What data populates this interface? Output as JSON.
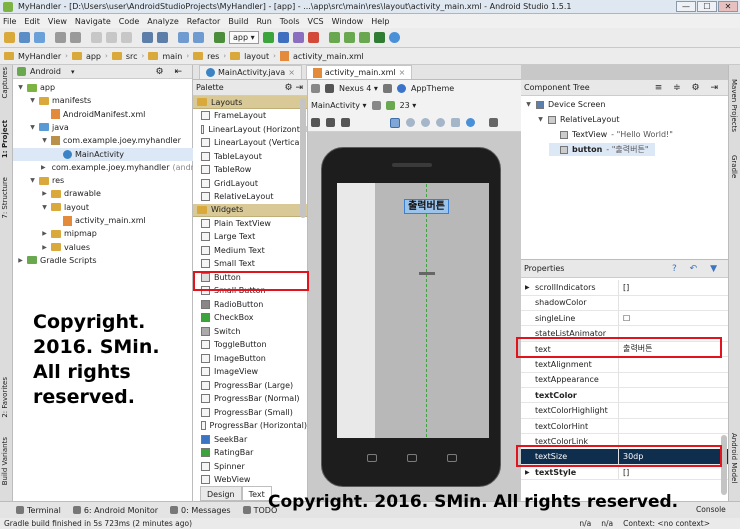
{
  "window": {
    "title": "MyHandler - [D:\\Users\\user\\AndroidStudioProjects\\MyHandler] - [app] - ...\\app\\src\\main\\res\\layout\\activity_main.xml - Android Studio 1.5.1",
    "minimize": "—",
    "maximize": "☐",
    "close": "✕"
  },
  "menu": [
    "File",
    "Edit",
    "View",
    "Navigate",
    "Code",
    "Analyze",
    "Refactor",
    "Build",
    "Run",
    "Tools",
    "VCS",
    "Window",
    "Help"
  ],
  "toolbar": {
    "run_config": "app ▾"
  },
  "breadcrumb": [
    "MyHandler",
    "app",
    "src",
    "main",
    "res",
    "layout",
    "activity_main.xml"
  ],
  "project": {
    "view_selector": "Android",
    "tree": [
      {
        "label": "app",
        "depth": 0,
        "icon": "folder",
        "color": "#7cb342"
      },
      {
        "label": "manifests",
        "depth": 1,
        "icon": "folder",
        "color": "#d9a93c"
      },
      {
        "label": "AndroidManifest.xml",
        "depth": 2,
        "icon": "xml",
        "color": "#e38b3a"
      },
      {
        "label": "java",
        "depth": 1,
        "icon": "folder",
        "color": "#5a9bd5"
      },
      {
        "label": "com.example.joey.myhandler",
        "depth": 2,
        "icon": "package",
        "color": "#b9914a"
      },
      {
        "label": "MainActivity",
        "depth": 3,
        "icon": "class",
        "color": "#3b83c4"
      },
      {
        "label": "com.example.joey.myhandler",
        "suffix": "(andro",
        "depth": 2,
        "icon": "package",
        "color": "#b9914a"
      },
      {
        "label": "res",
        "depth": 1,
        "icon": "folder",
        "color": "#d9a93c"
      },
      {
        "label": "drawable",
        "depth": 2,
        "icon": "folder",
        "color": "#d9a93c"
      },
      {
        "label": "layout",
        "depth": 2,
        "icon": "folder",
        "color": "#d9a93c"
      },
      {
        "label": "activity_main.xml",
        "depth": 3,
        "icon": "xml",
        "color": "#e38b3a"
      },
      {
        "label": "mipmap",
        "depth": 2,
        "icon": "folder",
        "color": "#d9a93c"
      },
      {
        "label": "values",
        "depth": 2,
        "icon": "folder",
        "color": "#d9a93c"
      },
      {
        "label": "Gradle Scripts",
        "depth": 0,
        "icon": "gradle",
        "color": "#6aa84f"
      }
    ]
  },
  "left_tool_tabs": [
    "Captures",
    "1: Project",
    "7: Structure",
    "2: Favorites",
    "Build Variants"
  ],
  "right_tool_tabs": [
    "Maven Projects",
    "Gradle",
    "Android Model"
  ],
  "editor_tabs": [
    {
      "label": "MainActivity.java",
      "active": false
    },
    {
      "label": "activity_main.xml",
      "active": true
    }
  ],
  "palette": {
    "title": "Palette",
    "groups": [
      {
        "name": "Layouts",
        "items": [
          "FrameLayout",
          "LinearLayout (Horizontal",
          "LinearLayout (Vertical)",
          "TableLayout",
          "TableRow",
          "GridLayout",
          "RelativeLayout"
        ]
      },
      {
        "name": "Widgets",
        "items": [
          "Plain TextView",
          "Large Text",
          "Medium Text",
          "Small Text",
          "Button",
          "Small Button",
          "RadioButton",
          "CheckBox",
          "Switch",
          "ToggleButton",
          "ImageButton",
          "ImageView",
          "ProgressBar (Large)",
          "ProgressBar (Normal)",
          "ProgressBar (Small)",
          "ProgressBar (Horizontal)",
          "SeekBar",
          "RatingBar",
          "Spinner",
          "WebView"
        ]
      }
    ]
  },
  "design_toolbar": {
    "device": "Nexus 4 ▾",
    "theme": "AppTheme",
    "activity": "MainActivity ▾",
    "api": "23 ▾"
  },
  "preview": {
    "button_text": "출력버튼"
  },
  "design_tabs": [
    "Design",
    "Text"
  ],
  "component_tree": {
    "title": "Component Tree",
    "nodes": [
      {
        "label": "Device Screen",
        "depth": 0
      },
      {
        "label": "RelativeLayout",
        "depth": 1
      },
      {
        "label": "TextView",
        "value": "- \"Hello World!\"",
        "depth": 2
      },
      {
        "label": "button",
        "value": "- \"출력버튼\"",
        "depth": 2,
        "selected": true
      }
    ]
  },
  "properties": {
    "title": "Properties",
    "rows": [
      {
        "name": "scrollIndicators",
        "value": "[]",
        "expand": true
      },
      {
        "name": "shadowColor",
        "value": ""
      },
      {
        "name": "singleLine",
        "value": "☐"
      },
      {
        "name": "stateListAnimator",
        "value": ""
      },
      {
        "name": "text",
        "value": "출력버튼"
      },
      {
        "name": "textAlignment",
        "value": ""
      },
      {
        "name": "textAppearance",
        "value": ""
      },
      {
        "name": "textColor",
        "value": "",
        "bold": true
      },
      {
        "name": "textColorHighlight",
        "value": ""
      },
      {
        "name": "textColorHint",
        "value": ""
      },
      {
        "name": "textColorLink",
        "value": ""
      },
      {
        "name": "textSize",
        "value": "30dp",
        "selected": true
      },
      {
        "name": "textStyle",
        "value": "[]",
        "expand": true,
        "bold": true
      }
    ]
  },
  "bottom_tabs": [
    "Terminal",
    "6: Android Monitor",
    "0: Messages",
    "TODO"
  ],
  "status": {
    "left": "Gradle build finished in 5s 723ms (2 minutes ago)",
    "right_na1": "n/a",
    "right_na2": "n/a",
    "context": "Context: <no context>",
    "console": "Console"
  },
  "watermarks": {
    "block_line1": "Copyright.",
    "block_line2": "2016. SMin.",
    "block_line3": "All rights",
    "block_line4": "reserved.",
    "bottom": "Copyright. 2016. SMin. All rights reserved."
  }
}
